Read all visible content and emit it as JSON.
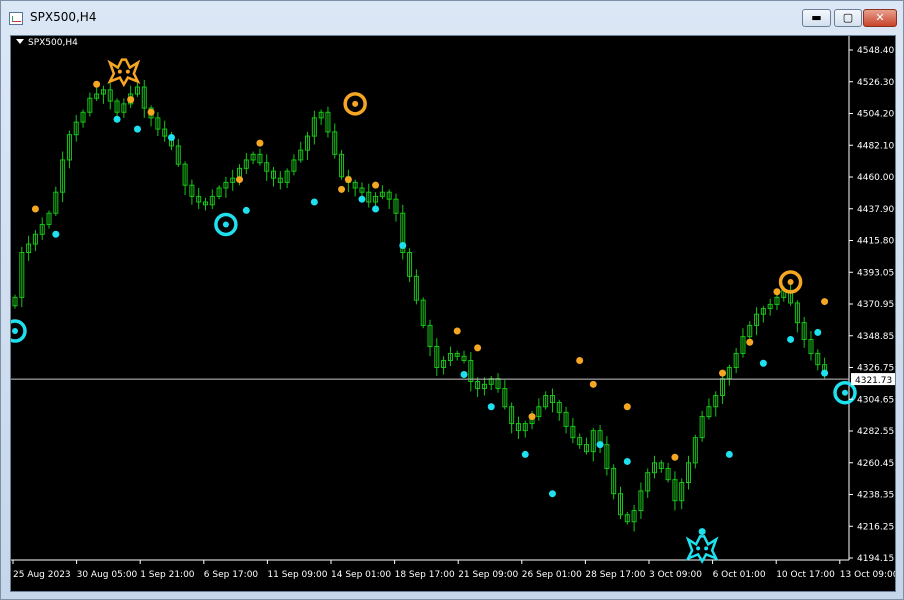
{
  "window": {
    "title": "SPX500,H4",
    "controls": [
      "minimize",
      "maximize",
      "close"
    ]
  },
  "chart_label": "SPX500,H4",
  "price_label": "4321.73",
  "colors": {
    "background": "#000000",
    "candle": "#18c418",
    "peak_dot": "#f5a623",
    "trough_dot": "#1ee0ee",
    "axis_text": "#ffffff",
    "price_line": "#c8c8c8"
  },
  "chart_data": {
    "type": "line",
    "title": "",
    "xlabel": "",
    "ylabel": "",
    "ylim": [
      4194.15,
      4556.4
    ],
    "grid": false,
    "y_ticks": [
      "4548.40",
      "4526.30",
      "4504.20",
      "4482.10",
      "4460.00",
      "4437.90",
      "4415.80",
      "4393.05",
      "4370.95",
      "4348.85",
      "4326.75",
      "4304.65",
      "4282.55",
      "4260.45",
      "4238.35",
      "4216.25",
      "4194.15"
    ],
    "x_ticks": [
      "25 Aug 2023",
      "30 Aug 05:00",
      "1 Sep 21:00",
      "6 Sep 17:00",
      "11 Sep 09:00",
      "14 Sep 01:00",
      "18 Sep 17:00",
      "21 Sep 09:00",
      "26 Sep 01:00",
      "28 Sep 17:00",
      "3 Oct 09:00",
      "6 Oct 01:00",
      "10 Oct 17:00",
      "13 Oct 09:00"
    ],
    "current_price": 4321.73,
    "series": [
      {
        "values": [
          4380,
          4412,
          4418,
          4425,
          4432,
          4440,
          4455,
          4478,
          4496,
          4505,
          4512,
          4522,
          4525,
          4528,
          4520,
          4512,
          4518,
          4525,
          4530,
          4515,
          4508,
          4500,
          4495,
          4488,
          4475,
          4460,
          4452,
          4448,
          4446,
          4452,
          4458,
          4462,
          4465,
          4472,
          4478,
          4482,
          4476,
          4470,
          4465,
          4462,
          4470,
          4478,
          4485,
          4495,
          4508,
          4512,
          4498,
          4482,
          4466,
          4462,
          4458,
          4455,
          4448,
          4452,
          4455,
          4450,
          4440,
          4412,
          4395,
          4378,
          4360,
          4345,
          4330,
          4335,
          4340,
          4338,
          4335,
          4320,
          4315,
          4318,
          4322,
          4315,
          4302,
          4290,
          4285,
          4290,
          4295,
          4302,
          4310,
          4305,
          4298,
          4288,
          4280,
          4275,
          4270,
          4285,
          4275,
          4258,
          4240,
          4225,
          4220,
          4228,
          4242,
          4255,
          4262,
          4258,
          4250,
          4235,
          4248,
          4262,
          4280,
          4295,
          4302,
          4310,
          4322,
          4330,
          4340,
          4352,
          4360,
          4368,
          4372,
          4375,
          4380,
          4385,
          4376,
          4362,
          4350,
          4340,
          4332,
          4325
        ]
      }
    ],
    "peak_markers": [
      {
        "i": 3,
        "v": 4443
      },
      {
        "i": 12,
        "v": 4532
      },
      {
        "i": 17,
        "v": 4521
      },
      {
        "i": 20,
        "v": 4512
      },
      {
        "i": 33,
        "v": 4464
      },
      {
        "i": 36,
        "v": 4490
      },
      {
        "i": 48,
        "v": 4457
      },
      {
        "i": 49,
        "v": 4464
      },
      {
        "i": 53,
        "v": 4460
      },
      {
        "i": 65,
        "v": 4356
      },
      {
        "i": 68,
        "v": 4344
      },
      {
        "i": 76,
        "v": 4295
      },
      {
        "i": 83,
        "v": 4335
      },
      {
        "i": 85,
        "v": 4318
      },
      {
        "i": 90,
        "v": 4302
      },
      {
        "i": 97,
        "v": 4266
      },
      {
        "i": 104,
        "v": 4326
      },
      {
        "i": 108,
        "v": 4348
      },
      {
        "i": 112,
        "v": 4384
      },
      {
        "i": 119,
        "v": 4377
      }
    ],
    "trough_markers": [
      {
        "i": 6,
        "v": 4425
      },
      {
        "i": 15,
        "v": 4507
      },
      {
        "i": 18,
        "v": 4500
      },
      {
        "i": 23,
        "v": 4494
      },
      {
        "i": 34,
        "v": 4442
      },
      {
        "i": 44,
        "v": 4448
      },
      {
        "i": 51,
        "v": 4450
      },
      {
        "i": 53,
        "v": 4443
      },
      {
        "i": 57,
        "v": 4417
      },
      {
        "i": 66,
        "v": 4325
      },
      {
        "i": 70,
        "v": 4302
      },
      {
        "i": 75,
        "v": 4268
      },
      {
        "i": 79,
        "v": 4240
      },
      {
        "i": 86,
        "v": 4275
      },
      {
        "i": 90,
        "v": 4263
      },
      {
        "i": 101,
        "v": 4213
      },
      {
        "i": 105,
        "v": 4268
      },
      {
        "i": 110,
        "v": 4333
      },
      {
        "i": 114,
        "v": 4350
      },
      {
        "i": 118,
        "v": 4355
      },
      {
        "i": 119,
        "v": 4326
      }
    ],
    "ring_markers": [
      {
        "kind": "trough",
        "i": 0,
        "v": 4356
      },
      {
        "kind": "trough",
        "i": 31,
        "v": 4432
      },
      {
        "kind": "peak",
        "i": 50,
        "v": 4518
      },
      {
        "kind": "peak",
        "i": 114,
        "v": 4391
      },
      {
        "kind": "trough",
        "i": 122,
        "v": 4312
      }
    ],
    "icon_markers": [
      {
        "kind": "peak",
        "icon": "bat-glyph-icon",
        "i": 16,
        "v": 4541
      },
      {
        "kind": "trough",
        "icon": "cat-face-icon",
        "i": 101,
        "v": 4201
      }
    ]
  }
}
